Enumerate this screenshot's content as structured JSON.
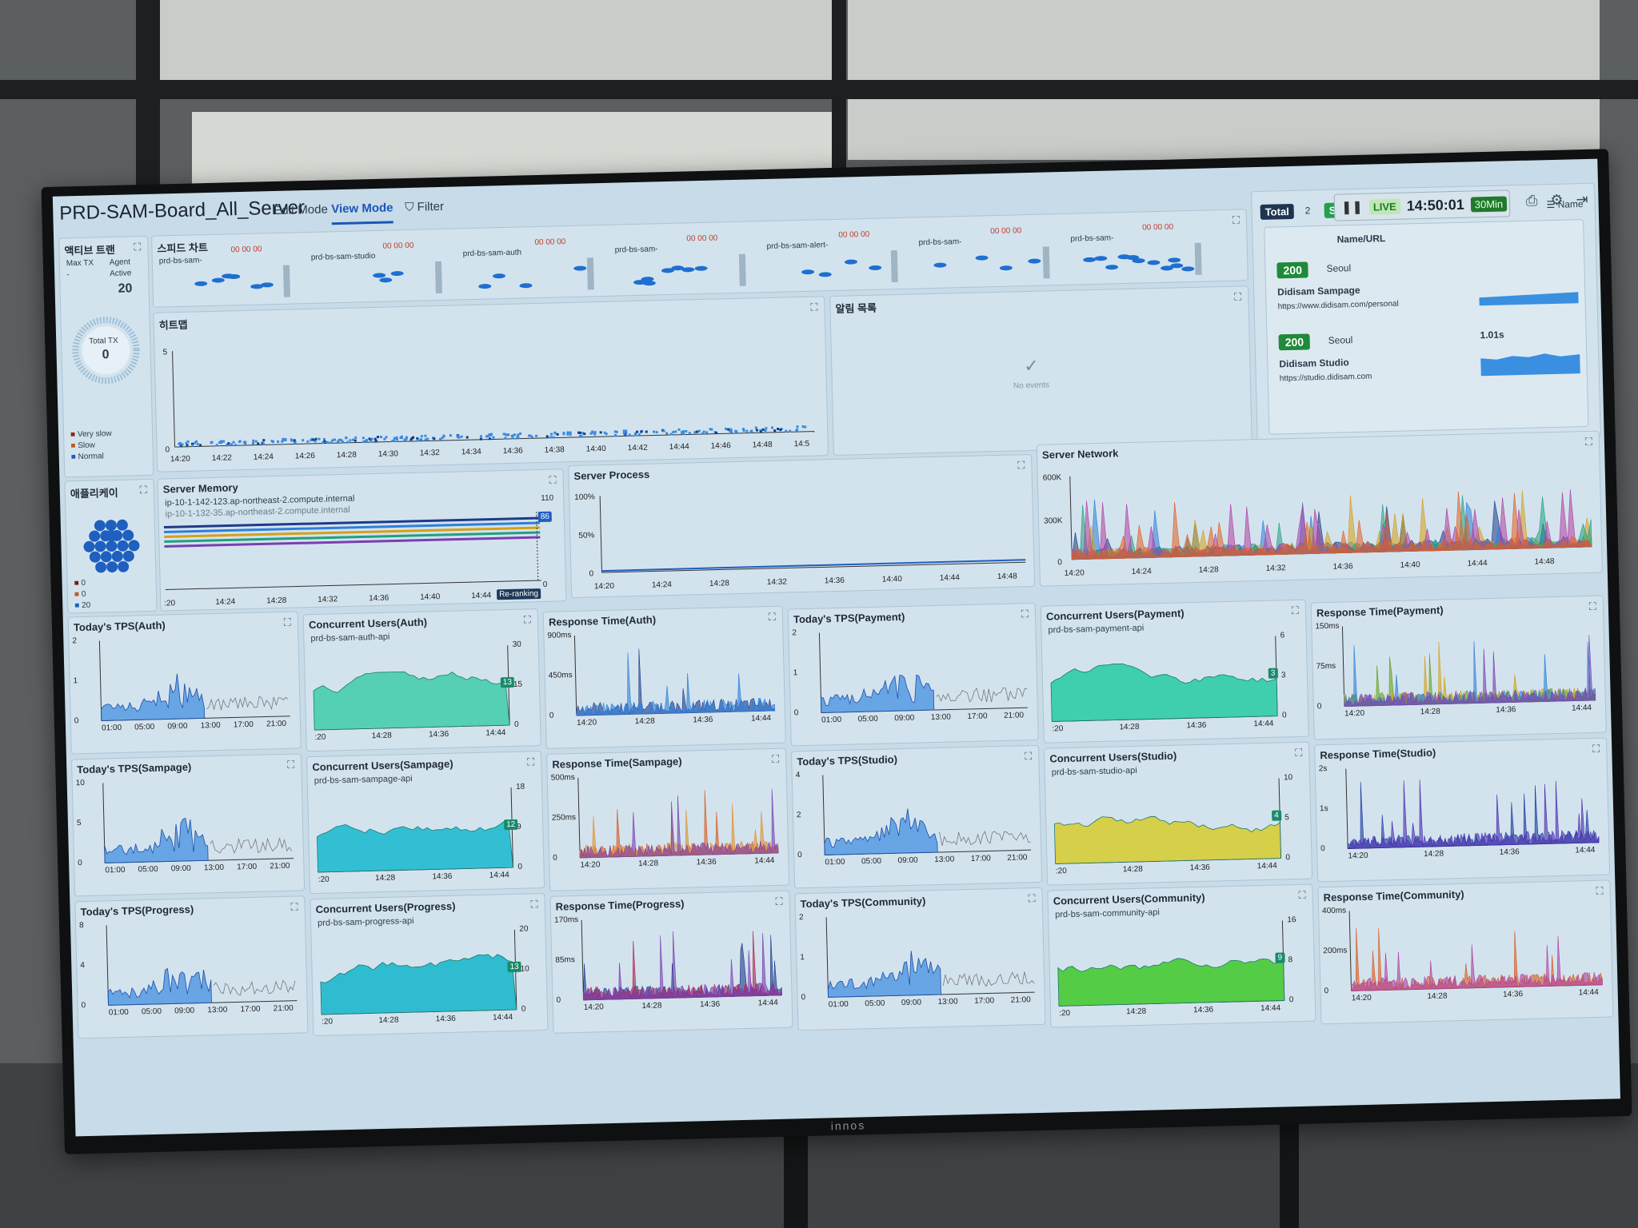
{
  "header": {
    "dashboard_title": "PRD-SAM-Board_All_Server",
    "tabs": [
      "Edit Mode",
      "View Mode",
      "Filter"
    ],
    "live_label": "LIVE",
    "clock": "14:50:01",
    "range": "30Min",
    "tv_brand": "innos"
  },
  "active_tx": {
    "title": "액티브 트랜",
    "max_tx": "Max TX",
    "agent": "Agent",
    "active": "Active",
    "dash": "-",
    "active_count": "20",
    "total_tx_label": "Total TX",
    "total_tx": "0",
    "legend": [
      "Very slow",
      "Slow",
      "Normal"
    ]
  },
  "speed_chart": {
    "title": "스피드 차트",
    "groups": [
      "prd-bs-sam-",
      "prd-bs-sam-studio",
      "prd-bs-sam-auth",
      "prd-bs-sam-",
      "prd-bs-sam-alert-",
      "prd-bs-sam-",
      "prd-bs-sam-"
    ],
    "counter": "00 00 00"
  },
  "heatmap": {
    "title": "히트맵",
    "y": [
      "5",
      "0"
    ],
    "x": [
      "14:20",
      "14:22",
      "14:24",
      "14:26",
      "14:28",
      "14:30",
      "14:32",
      "14:34",
      "14:36",
      "14:38",
      "14:40",
      "14:42",
      "14:44",
      "14:46",
      "14:48",
      "14:5"
    ]
  },
  "alerts": {
    "title": "알림 목록",
    "empty": "No events"
  },
  "urls": {
    "total_label": "Total",
    "total": "2",
    "success_label": "Success",
    "success": "2",
    "sort": "Name",
    "col": "Name/URL",
    "items": [
      {
        "status": "200",
        "region": "Seoul",
        "name": "Didisam Sampage",
        "url": "https://www.didisam.com/personal",
        "value": ""
      },
      {
        "status": "200",
        "region": "Seoul",
        "name": "Didisam Studio",
        "url": "https://studio.didisam.com",
        "value": "1.01s"
      }
    ]
  },
  "app": {
    "title": "애플리케이",
    "counts": [
      "0",
      "0",
      "20"
    ]
  },
  "server_memory": {
    "title": "Server Memory",
    "series": [
      "ip-10-1-142-123.ap-northeast-2.compute.internal",
      "ip-10-1-132-35.ap-northeast-2.compute.internal"
    ],
    "y": [
      "110",
      "0"
    ],
    "badge": "86",
    "x": [
      ":20",
      "14:24",
      "14:28",
      "14:32",
      "14:36",
      "14:40",
      "14:44"
    ],
    "reranking": "Re-ranking"
  },
  "server_process": {
    "title": "Server Process",
    "y": [
      "100%",
      "50%",
      "0"
    ],
    "x": [
      "14:20",
      "14:24",
      "14:28",
      "14:32",
      "14:36",
      "14:40",
      "14:44",
      "14:48"
    ]
  },
  "server_network": {
    "title": "Server Network",
    "y": [
      "600K",
      "300K",
      "0"
    ],
    "x": [
      "14:20",
      "14:24",
      "14:28",
      "14:32",
      "14:36",
      "14:40",
      "14:44",
      "14:48"
    ]
  },
  "chart_data": [
    {
      "type": "area",
      "title": "Today's TPS(Auth)",
      "y": [
        "2",
        "1",
        "0"
      ],
      "x": [
        "01:00",
        "05:00",
        "09:00",
        "13:00",
        "17:00",
        "21:00"
      ]
    },
    {
      "type": "area",
      "title": "Concurrent Users(Auth)",
      "series": "prd-bs-sam-auth-api",
      "y": [
        "30",
        "15",
        "0"
      ],
      "x": [
        ":20",
        "14:28",
        "14:36",
        "14:44"
      ],
      "current": "13"
    },
    {
      "type": "line",
      "title": "Response Time(Auth)",
      "y": [
        "900ms",
        "450ms",
        "0"
      ],
      "x": [
        "14:20",
        "14:28",
        "14:36",
        "14:44"
      ]
    },
    {
      "type": "area",
      "title": "Today's TPS(Payment)",
      "y": [
        "2",
        "1",
        "0"
      ],
      "x": [
        "01:00",
        "05:00",
        "09:00",
        "13:00",
        "17:00",
        "21:00"
      ]
    },
    {
      "type": "area",
      "title": "Concurrent Users(Payment)",
      "series": "prd-bs-sam-payment-api",
      "y": [
        "6",
        "3",
        "0"
      ],
      "x": [
        ":20",
        "14:28",
        "14:36",
        "14:44"
      ],
      "current": "3"
    },
    {
      "type": "line",
      "title": "Response Time(Payment)",
      "y": [
        "150ms",
        "75ms",
        "0"
      ],
      "x": [
        "14:20",
        "14:28",
        "14:36",
        "14:44"
      ]
    },
    {
      "type": "area",
      "title": "Today's TPS(Sampage)",
      "y": [
        "10",
        "5",
        "0"
      ],
      "x": [
        "01:00",
        "05:00",
        "09:00",
        "13:00",
        "17:00",
        "21:00"
      ]
    },
    {
      "type": "area",
      "title": "Concurrent Users(Sampage)",
      "series": "prd-bs-sam-sampage-api",
      "y": [
        "18",
        "9",
        "0"
      ],
      "x": [
        ":20",
        "14:28",
        "14:36",
        "14:44"
      ],
      "current": "12"
    },
    {
      "type": "line",
      "title": "Response Time(Sampage)",
      "y": [
        "500ms",
        "250ms",
        "0"
      ],
      "x": [
        "14:20",
        "14:28",
        "14:36",
        "14:44"
      ]
    },
    {
      "type": "area",
      "title": "Today's TPS(Studio)",
      "y": [
        "4",
        "2",
        "0"
      ],
      "x": [
        "01:00",
        "05:00",
        "09:00",
        "13:00",
        "17:00",
        "21:00"
      ]
    },
    {
      "type": "area",
      "title": "Concurrent Users(Studio)",
      "series": "prd-bs-sam-studio-api",
      "y": [
        "10",
        "5",
        "0"
      ],
      "x": [
        ":20",
        "14:28",
        "14:36",
        "14:44"
      ],
      "current": "4"
    },
    {
      "type": "line",
      "title": "Response Time(Studio)",
      "y": [
        "2s",
        "1s",
        "0"
      ],
      "x": [
        "14:20",
        "14:28",
        "14:36",
        "14:44"
      ]
    },
    {
      "type": "area",
      "title": "Today's TPS(Progress)",
      "y": [
        "8",
        "4",
        "0"
      ],
      "x": [
        "01:00",
        "05:00",
        "09:00",
        "13:00",
        "17:00",
        "21:00"
      ]
    },
    {
      "type": "area",
      "title": "Concurrent Users(Progress)",
      "series": "prd-bs-sam-progress-api",
      "y": [
        "20",
        "10",
        "0"
      ],
      "x": [
        ":20",
        "14:28",
        "14:36",
        "14:44"
      ],
      "current": "13"
    },
    {
      "type": "line",
      "title": "Response Time(Progress)",
      "y": [
        "170ms",
        "85ms",
        "0"
      ],
      "x": [
        "14:20",
        "14:28",
        "14:36",
        "14:44"
      ]
    },
    {
      "type": "area",
      "title": "Today's TPS(Community)",
      "y": [
        "2",
        "1",
        "0"
      ],
      "x": [
        "01:00",
        "05:00",
        "09:00",
        "13:00",
        "17:00",
        "21:00"
      ]
    },
    {
      "type": "area",
      "title": "Concurrent Users(Community)",
      "series": "prd-bs-sam-community-api",
      "y": [
        "16",
        "8",
        "0"
      ],
      "x": [
        ":20",
        "14:28",
        "14:36",
        "14:44"
      ],
      "current": "9"
    },
    {
      "type": "line",
      "title": "Response Time(Community)",
      "y": [
        "400ms",
        "200ms",
        "0"
      ],
      "x": [
        "14:20",
        "14:28",
        "14:36",
        "14:44"
      ]
    }
  ]
}
